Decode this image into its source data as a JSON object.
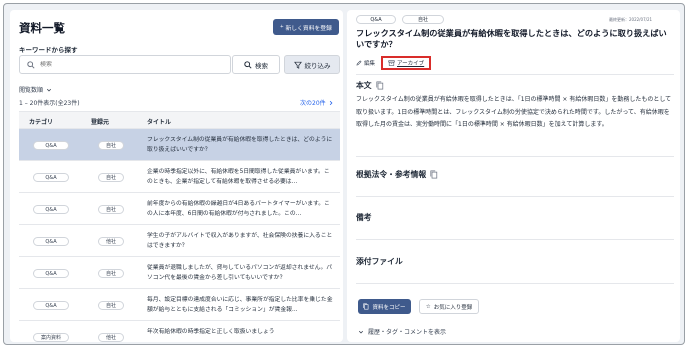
{
  "list": {
    "title": "資料一覧",
    "new_button": "新しく資料を登録",
    "keyword_label": "キーワードから探す",
    "search_placeholder": "検索",
    "search_button": "検索",
    "filter_button": "絞り込み",
    "sort_label": "閲覧数順",
    "count_text": "1 – 20件表示(全23件)",
    "next_link": "次の20件",
    "columns": [
      "カテゴリ",
      "登録元",
      "タイトル"
    ],
    "rows": [
      {
        "category": "Q&A",
        "source": "自社",
        "title": "フレックスタイム制の従業員が有給休暇を取得したときは、どのように取り扱えばいいですか？"
      },
      {
        "category": "Q&A",
        "source": "自社",
        "title": "企業の時季指定以外に、有給休暇を5日間取得した従業員がいます。このときも、企業が指定して有給休暇を取得させる必要は…"
      },
      {
        "category": "Q&A",
        "source": "自社",
        "title": "前年度からの有給休暇の繰越日が4日あるパートタイマーがいます。この人に本年度、6日間の有給休暇が付与されました。この…"
      },
      {
        "category": "Q&A",
        "source": "他社",
        "title": "学生の子がアルバイトで収入がありますが、社会保険の扶養に入ることはできますか？"
      },
      {
        "category": "Q&A",
        "source": "自社",
        "title": "従業員が退職しましたが、貸与しているパソコンが返却されません。パソコン代を最後の賃金から差し引いてもいいですか？"
      },
      {
        "category": "Q&A",
        "source": "自社",
        "title": "毎月、設定目標の達成度合いに応じ、事業所が指定した比率を乗じた金額が給与とともに支給される「コミッション」が賃金報…"
      },
      {
        "category": "案内資料",
        "source": "他社",
        "title": "年次有給休暇の時季指定と正しく取扱いましょう"
      }
    ]
  },
  "detail": {
    "tags": [
      "Q&A",
      "自社"
    ],
    "updated": "最終更新：2022/07/21",
    "title": "フレックスタイム制の従業員が有給休暇を取得したときは、どのように取り扱えばいいですか？",
    "edit_label": "編集",
    "archive_label": "アーカイブ",
    "body_heading": "本文",
    "body_text": "フレックスタイム制の従業員が有給休暇を取得したときは、「1日の標準時間 × 有給休暇日数」を勤務したものとして取り扱います。1日の標準時間とは、フレックスタイム制の労使協定で決められた時間です。したがって、有給休暇を取得した月の賃金は、実労働時間に「1日の標準時間 × 有給休暇日数」を加えて計算します。",
    "law_heading": "根拠法令・参考情報",
    "notes_heading": "備考",
    "attachments_heading": "添付ファイル",
    "copy_button": "資料をコピー",
    "favorite_button": "お気に入り登録",
    "history_toggle": "履歴・タグ・コメントを表示"
  },
  "colors": {
    "primary": "#3f5a8c",
    "selected_row": "#c7d2e5",
    "highlight_border": "#d92d2a",
    "link": "#2563eb"
  }
}
